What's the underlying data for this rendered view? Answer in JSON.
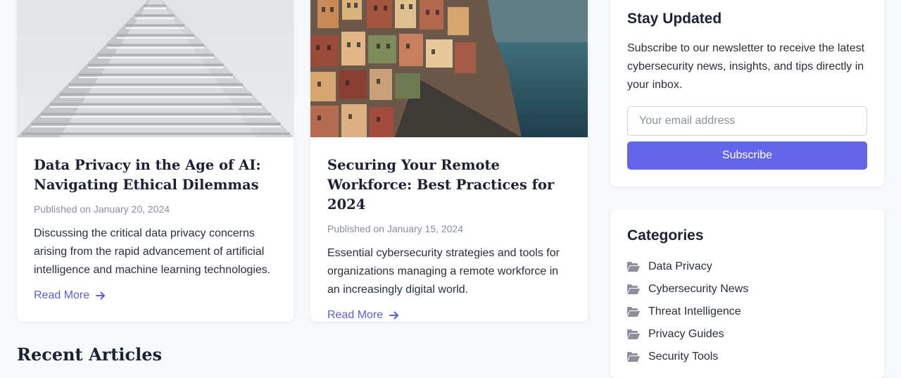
{
  "articles": [
    {
      "title": "Data Privacy in the Age of AI: Navigating Ethical Dilemmas",
      "meta": "Published on January 20, 2024",
      "excerpt": "Discussing the critical data privacy concerns arising from the rapid advancement of artificial intelligence and machine learning technologies.",
      "read_more": "Read More",
      "image": "white-stepped-building-photo"
    },
    {
      "title": "Securing Your Remote Workforce: Best Practices for 2024",
      "meta": "Published on January 15, 2024",
      "excerpt": "Essential cybersecurity strategies and tools for organizations managing a remote workforce in an increasingly digital world.",
      "read_more": "Read More",
      "image": "cliffside-village-photo"
    }
  ],
  "recent_articles_heading": "Recent Articles",
  "newsletter": {
    "title": "Stay Updated",
    "text": "Subscribe to our newsletter to receive the latest cybersecurity news, insights, and tips directly in your inbox.",
    "email_placeholder": "Your email address",
    "email_value": "",
    "button_label": "Subscribe"
  },
  "categories": {
    "title": "Categories",
    "items": [
      {
        "label": "Data Privacy",
        "icon": "folder-open-icon"
      },
      {
        "label": "Cybersecurity News",
        "icon": "folder-open-icon"
      },
      {
        "label": "Threat Intelligence",
        "icon": "folder-open-icon"
      },
      {
        "label": "Privacy Guides",
        "icon": "folder-open-icon"
      },
      {
        "label": "Security Tools",
        "icon": "folder-open-icon"
      }
    ]
  },
  "colors": {
    "accent": "#6366e9",
    "link": "#5b5fd6",
    "page_background": "#f7f8fa",
    "muted_text": "#8a8f99"
  }
}
